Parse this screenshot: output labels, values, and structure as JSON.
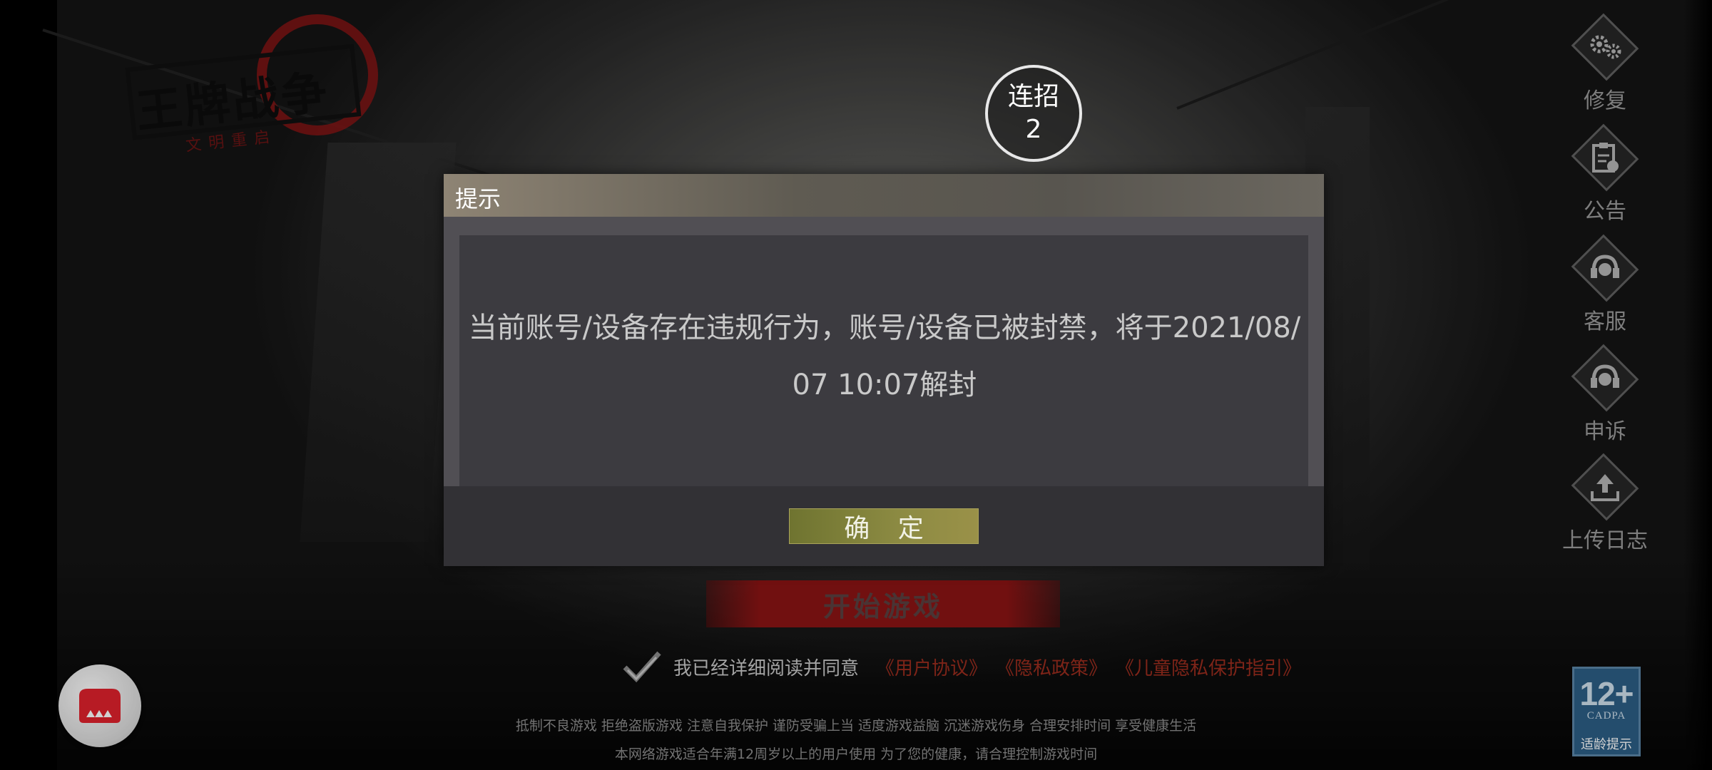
{
  "logo": {
    "title": "王牌战争",
    "subtitle": "文明重启"
  },
  "combo": {
    "label": "连招",
    "count": "2"
  },
  "side_menu": [
    {
      "label": "修复",
      "icon": "gears-icon"
    },
    {
      "label": "公告",
      "icon": "clipboard-icon"
    },
    {
      "label": "客服",
      "icon": "headset-icon"
    },
    {
      "label": "申诉",
      "icon": "headset-icon"
    },
    {
      "label": "上传日志",
      "icon": "upload-icon"
    }
  ],
  "start_button": "开始游戏",
  "agreement": {
    "text": "我已经详细阅读并同意",
    "links": [
      "《用户协议》",
      "《隐私政策》",
      "《儿童隐私保护指引》"
    ]
  },
  "footer": {
    "line1": "抵制不良游戏 拒绝盗版游戏 注意自我保护 谨防受骗上当 适度游戏益脑 沉迷游戏伤身 合理安排时间 享受健康生活",
    "line2": "本网络游戏适合年满12周岁以上的用户使用    为了您的健康，请合理控制游戏时间"
  },
  "age_rating": {
    "number": "12+",
    "org": "CADPA",
    "tip": "适龄提示"
  },
  "dialog": {
    "title": "提示",
    "message": "当前账号/设备存在违规行为，账号/设备已被封禁，将于2021/08/07 10:07解封",
    "confirm_label": "确 定"
  },
  "colors": {
    "dialog_bg": "#38373a",
    "confirm_bg": "#8d8b43",
    "link_red": "#9a2c1e",
    "start_red": "#8a1414"
  }
}
